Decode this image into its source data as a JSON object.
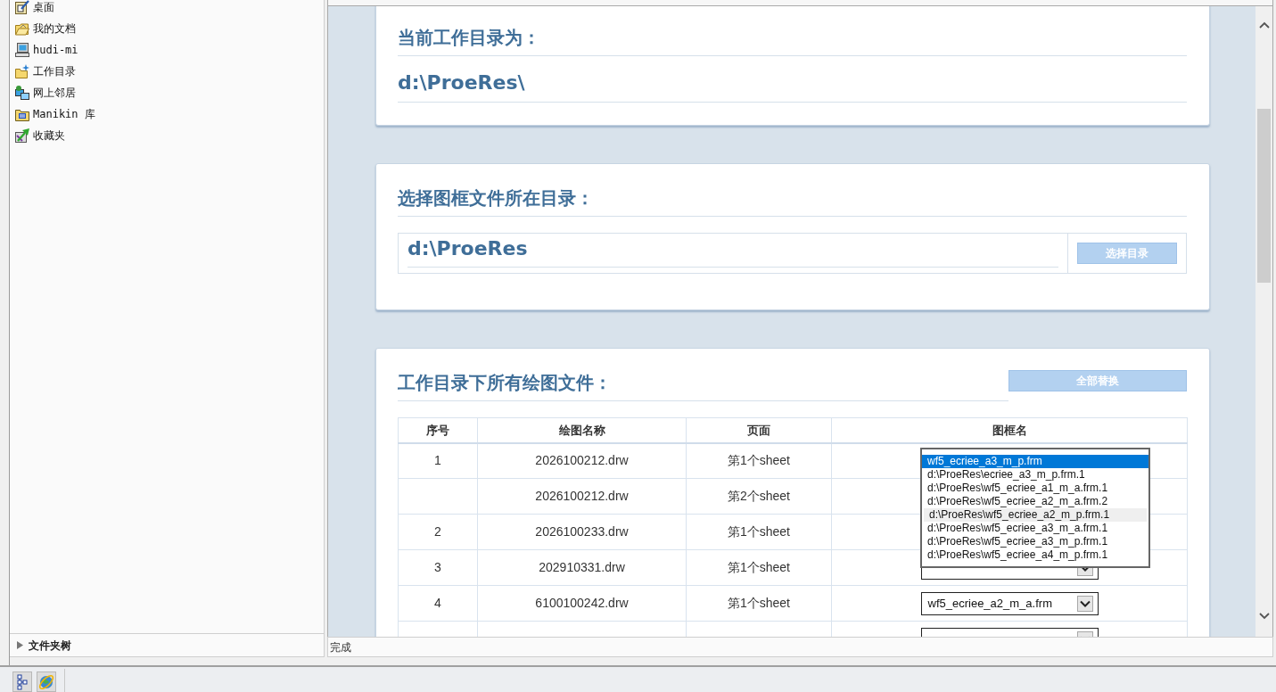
{
  "sidebar": {
    "items": [
      {
        "kind": "desktop",
        "label": "桌面"
      },
      {
        "kind": "documents",
        "label": "我的文档"
      },
      {
        "kind": "computer",
        "label": "hudi-mi"
      },
      {
        "kind": "workdir",
        "label": "工作目录"
      },
      {
        "kind": "network",
        "label": "网上邻居"
      },
      {
        "kind": "library",
        "label": "Manikin 库"
      },
      {
        "kind": "favorites",
        "label": "收藏夹"
      }
    ],
    "folder_tree": {
      "label": "文件夹树",
      "expanded": false
    }
  },
  "toolbar": {
    "buttons": [
      {
        "kind": "tree"
      },
      {
        "kind": "browser"
      }
    ]
  },
  "current_dir": {
    "title": "当前工作目录为：",
    "value": "d:\\ProeRes\\"
  },
  "frame_dir": {
    "title": "选择图框文件所在目录：",
    "value": "d:\\ProeRes",
    "button": "选择目录"
  },
  "drawings": {
    "title": "工作目录下所有绘图文件：",
    "button": "全部替换",
    "table": {
      "columns": [
        "序号",
        "绘图名称",
        "页面",
        "图框名"
      ],
      "rows": [
        {
          "no": "1",
          "name": "2026100212.drw",
          "page": "第1个sheet",
          "dropdown": {
            "options": [
              {
                "label": "wf5_ecriee_a3_m_p.frm",
                "selected": true,
                "hovered": false
              },
              {
                "label": "d:\\ProeRes\\ecriee_a3_m_p.frm.1",
                "selected": false,
                "hovered": false
              },
              {
                "label": "d:\\ProeRes\\wf5_ecriee_a1_m_a.frm.1",
                "selected": false,
                "hovered": false
              },
              {
                "label": "d:\\ProeRes\\wf5_ecriee_a2_m_a.frm.2",
                "selected": false,
                "hovered": false
              },
              {
                "label": "d:\\ProeRes\\wf5_ecriee_a2_m_p.frm.1",
                "selected": false,
                "hovered": true
              },
              {
                "label": "d:\\ProeRes\\wf5_ecriee_a3_m_a.frm.1",
                "selected": false,
                "hovered": false
              },
              {
                "label": "d:\\ProeRes\\wf5_ecriee_a3_m_p.frm.1",
                "selected": false,
                "hovered": false
              },
              {
                "label": "d:\\ProeRes\\wf5_ecriee_a4_m_p.frm.1",
                "selected": false,
                "hovered": false
              }
            ]
          }
        },
        {
          "name": "2026100212.drw",
          "page": "第2个sheet"
        },
        {
          "no": "2",
          "name": "2026100233.drw",
          "page": "第1个sheet"
        },
        {
          "no": "3",
          "name": "202910331.drw",
          "page": "第1个sheet",
          "select": true
        },
        {
          "no": "4",
          "name": "6100100242.drw",
          "page": "第1个sheet",
          "select": true,
          "frame": "wf5_ecriee_a2_m_a.frm"
        },
        {
          "select": true
        }
      ]
    }
  },
  "status_bar": {
    "text": "完成"
  }
}
